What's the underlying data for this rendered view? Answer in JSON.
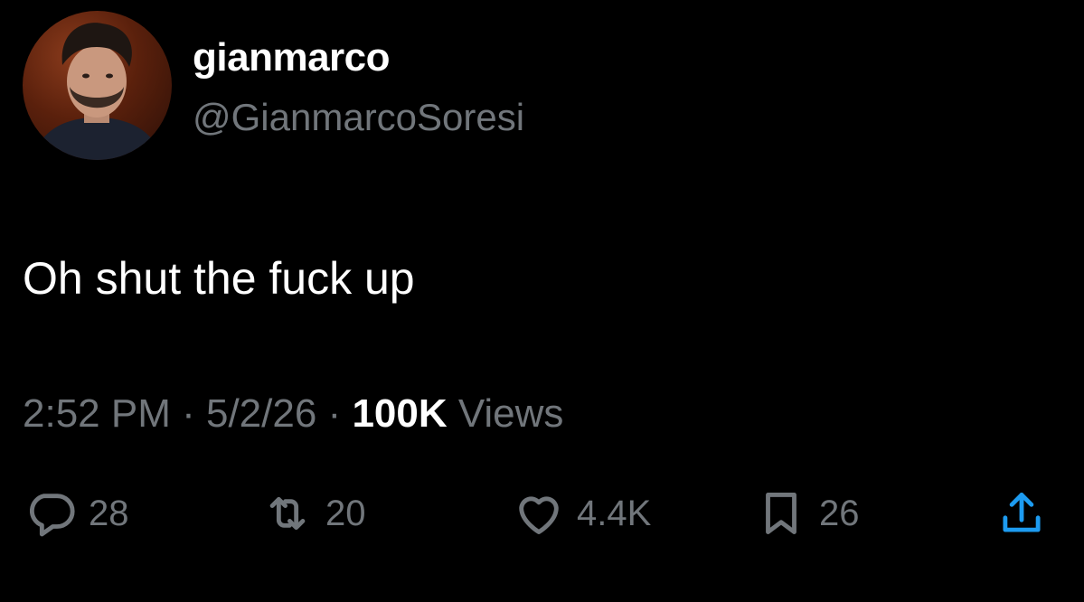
{
  "author": {
    "display_name": "gianmarco",
    "handle": "@GianmarcoSoresi",
    "avatar_icon": "profile-photo"
  },
  "tweet": {
    "text": "Oh shut the fuck up"
  },
  "meta": {
    "time": "2:52 PM",
    "separator1": " · ",
    "date": "5/2/26",
    "separator2": " · ",
    "views_count": "100K",
    "views_label": " Views"
  },
  "actions": {
    "reply": {
      "icon": "reply-icon",
      "count": "28"
    },
    "retweet": {
      "icon": "retweet-icon",
      "count": "20"
    },
    "like": {
      "icon": "heart-icon",
      "count": "4.4K"
    },
    "bookmark": {
      "icon": "bookmark-icon",
      "count": "26"
    },
    "share": {
      "icon": "share-icon"
    }
  },
  "colors": {
    "background": "#000000",
    "primary_text": "#ffffff",
    "secondary_text": "#71767b"
  }
}
